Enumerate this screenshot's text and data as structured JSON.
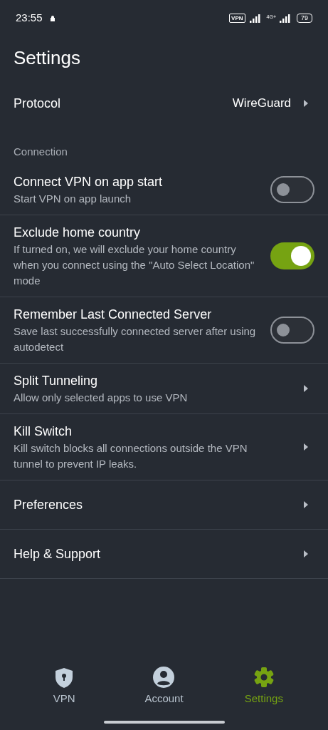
{
  "status_bar": {
    "time": "23:55",
    "vpn_badge": "VPN",
    "network": "4G+",
    "battery": "79"
  },
  "title": "Settings",
  "items": [
    {
      "kind": "value",
      "label": "Protocol",
      "value": "WireGuard"
    },
    {
      "kind": "header",
      "label": "Connection"
    },
    {
      "kind": "toggle",
      "label": "Connect VPN on app start",
      "description": "Start VPN on app launch",
      "on": false
    },
    {
      "kind": "toggle",
      "label": "Exclude home country",
      "description": "If turned on, we will exclude your home country when you connect using the \"Auto Select Location\" mode",
      "on": true
    },
    {
      "kind": "toggle",
      "label": "Remember Last Connected Server",
      "description": "Save last successfully connected server after using autodetect",
      "on": false
    },
    {
      "kind": "nav",
      "label": "Split Tunneling",
      "description": "Allow only selected apps to use VPN"
    },
    {
      "kind": "nav",
      "label": "Kill Switch",
      "description": "Kill switch blocks all connections outside the VPN tunnel to prevent IP leaks."
    },
    {
      "kind": "nav",
      "label": "Preferences"
    },
    {
      "kind": "nav",
      "label": "Help & Support"
    }
  ],
  "bottom_nav": [
    {
      "kind": "shield",
      "label": "VPN",
      "selected": false
    },
    {
      "kind": "person",
      "label": "Account",
      "selected": false
    },
    {
      "kind": "gear",
      "label": "Settings",
      "selected": true
    }
  ]
}
